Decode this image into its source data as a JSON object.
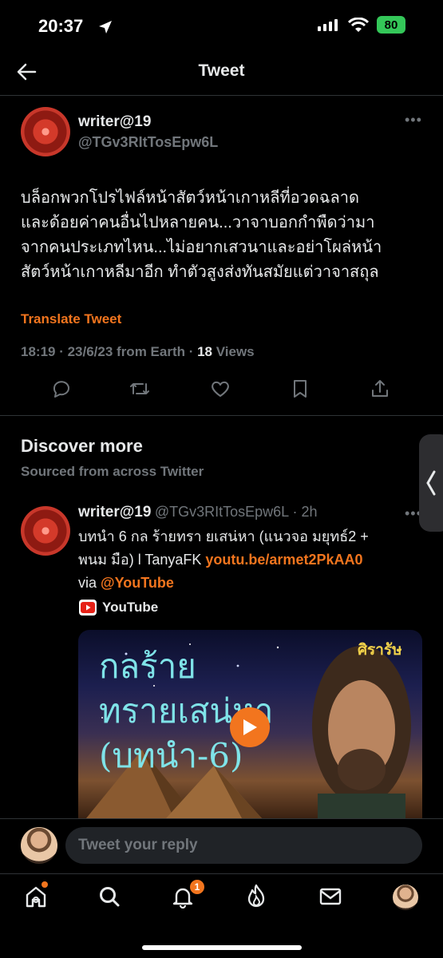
{
  "status": {
    "time": "20:37",
    "battery": "80"
  },
  "header": {
    "title": "Tweet"
  },
  "tweet": {
    "name": "writer@19",
    "handle": "@TGv3RItTosEpw6L",
    "lines": [
      "บล็อกพวกโปรไฟล์หน้าสัตว์หน้าเกาหลีที่อวดฉลาด",
      "และด้อยค่าคนอื่นไปหลายคน...วาจาบอกกำพืดว่ามา",
      "จากคนประเภทไหน...ไม่อยากเสวนาและอย่าโผล่หน้า",
      "สัตว์หน้าเกาหลีมาอีก ทำตัวสูงส่งทันสมัยแต่วาจาสถุล"
    ],
    "translate": "Translate Tweet",
    "meta": "18:19 · 23/6/23 from Earth · ",
    "views_count": "18",
    "views_label": " Views"
  },
  "discover": {
    "title": "Discover more",
    "subtitle": "Sourced from across Twitter"
  },
  "related": {
    "name": "writer@19",
    "handle_time": "@TGv3RItTosEpw6L · 2h",
    "line1": "บทนำ 6 กล ร้ายทรา ยเสน่หา  (แนวจอ มยุทธ์2 +",
    "line2_text": "พนม มือ) l TanyaFK ",
    "link": "youtu.be/armet2PkAA0",
    "line3_text": "via ",
    "mention": "@YouTube",
    "source": "YouTube",
    "thumb_title_1": "กลร้าย",
    "thumb_title_2": "ทรายเสน่หา",
    "thumb_title_3": "(บทนำ-6)",
    "thumb_author": "ศิรารัษ"
  },
  "reply": {
    "placeholder": "Tweet your reply"
  },
  "nav": {
    "notif_badge": "1"
  },
  "colors": {
    "accent": "#f2751e",
    "bg": "#000000",
    "muted": "#71767b",
    "battery": "#34c759"
  },
  "icons": [
    "back-arrow-icon",
    "more-icon",
    "reply-icon",
    "retweet-icon",
    "like-icon",
    "bookmark-icon",
    "share-icon",
    "youtube-icon",
    "play-icon",
    "home-icon",
    "search-icon",
    "bell-icon",
    "spaces-icon",
    "mail-icon"
  ]
}
